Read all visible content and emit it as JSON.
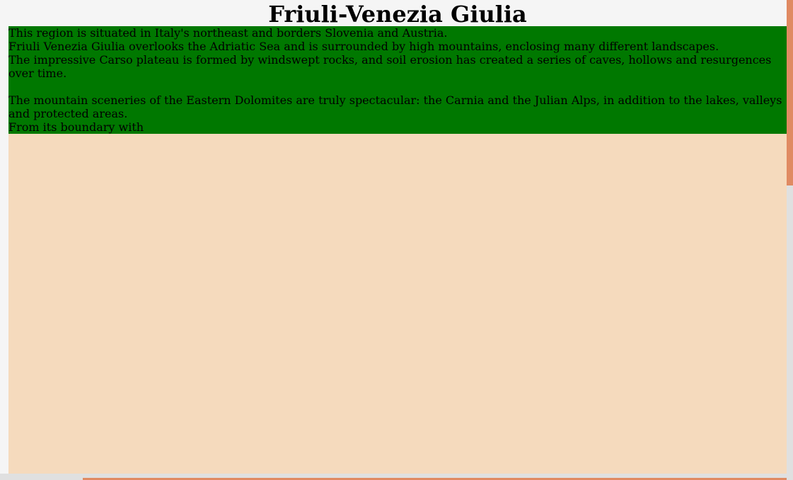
{
  "page": {
    "title": "Friuli-Venezia Giulia"
  },
  "intro": {
    "paragraphs": [
      "This region is situated in Italy's northeast and borders Slovenia and Austria.",
      "Friuli Venezia Giulia overlooks the Adriatic Sea and is surrounded by high mountains, enclosing many different landscapes.",
      "The impressive Carso plateau is formed by windswept rocks, and soil erosion has created a series of caves, hollows and resurgences over time.",
      "The mountain sceneries of the Eastern Dolomites are truly spectacular: the Carnia and the Julian Alps, in addition to the lakes, valleys and protected areas.",
      "From its boundary with"
    ]
  },
  "colors": {
    "intro_background": "#007800",
    "content_background": "#f5dabd",
    "page_background": "#f5f5f5",
    "scrollbar_thumb": "#e08a62",
    "scrollbar_track": "#e0e0e0"
  }
}
